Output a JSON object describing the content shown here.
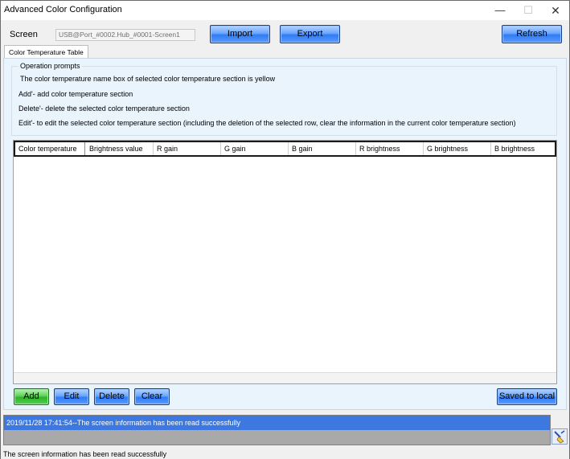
{
  "window": {
    "title": "Advanced Color Configuration",
    "minimize": "—",
    "maximize": "☐",
    "close": "✕"
  },
  "toolbar": {
    "screen_label": "Screen",
    "screen_value": "USB@Port_#0002.Hub_#0001-Screen1",
    "import_label": "Import",
    "export_label": "Export",
    "refresh_label": "Refresh"
  },
  "tabs": [
    {
      "label": "Color Temperature Table",
      "active": true
    }
  ],
  "prompts": {
    "title": "Operation prompts",
    "lines": [
      "The color temperature name box of selected color temperature section is yellow",
      "Add'- add color temperature section",
      "Delete'- delete the selected color temperature section",
      "Edit'- to edit the selected color temperature section (including the deletion of the selected row, clear the information in the current color temperature section)"
    ]
  },
  "table": {
    "columns": [
      "Color temperature",
      "Brightness value",
      "R gain",
      "G gain",
      "B gain",
      "R brightness",
      "G brightness",
      "B brightness"
    ],
    "rows": []
  },
  "actions": {
    "add_label": "Add",
    "edit_label": "Edit",
    "delete_label": "Delete",
    "clear_label": "Clear",
    "saved_label": "Saved to local"
  },
  "log": {
    "entries": [
      "2019/11/28 17:41:54--The screen information has been read successfully"
    ],
    "clear_icon": "broom-icon"
  },
  "status": {
    "text": "The screen information has been read successfully"
  },
  "colors": {
    "button_blue": "#2f7cf5",
    "button_green": "#2fb32a",
    "log_highlight": "#3d78e0",
    "panel_bg": "#eaf4fc"
  }
}
